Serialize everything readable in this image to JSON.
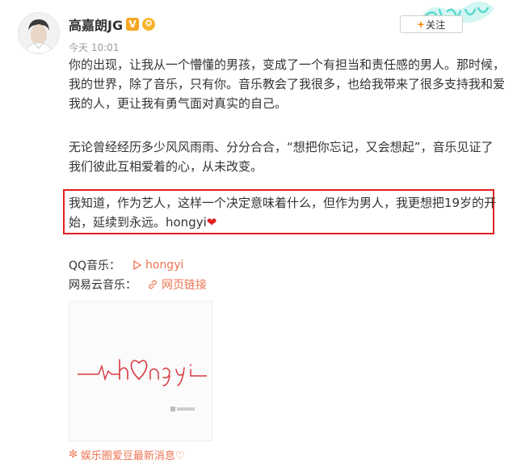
{
  "post": {
    "username": "高嘉朗JG",
    "verified_badge": "V",
    "time": "今天 10:01",
    "follow_label": "关注",
    "paragraphs": [
      "你的出现，让我从一个懵懂的男孩，变成了一个有担当和责任感的男人。那时候，我的世界，除了音乐，只有你。音乐教会了我很多，也给我带来了很多支持我和爱我的人，更让我有勇气面对真实的自己。",
      "无论曾经经历多少风风雨雨、分分合合，“想把你忘记，又会想起”，音乐见证了我们彼此互相爱着的心，从未改变。",
      "我知道，作为艺人，这样一个决定意味着什么，但作为男人，我更想把19岁的开始，延续到永远。hongyi"
    ]
  },
  "links": {
    "qq_label": "QQ音乐：",
    "qq_value": "hongyi",
    "netease_label": "网易云音乐：",
    "netease_value": "网页链接"
  },
  "cover_image": {
    "handwriting": "hongyi"
  },
  "caption": "娱乐圈爱豆最新消息♡",
  "colors": {
    "highlight_border": "#e02020",
    "link_orange": "#eb7350",
    "heart_red": "#e02020",
    "badge_gold": "#f5a623"
  },
  "icons": [
    "avatar",
    "verified-badge-icon",
    "medal-icon",
    "plus-icon",
    "play-icon",
    "link-icon",
    "heart-icon",
    "flower-icon"
  ]
}
